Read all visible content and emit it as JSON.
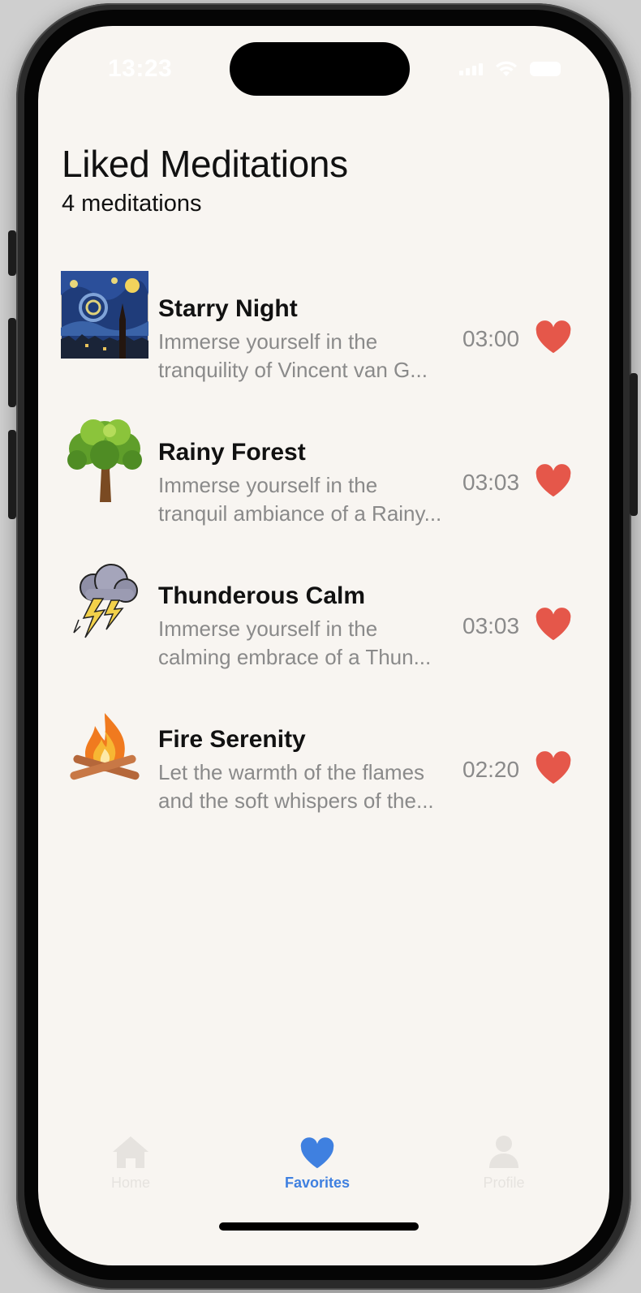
{
  "status_bar": {
    "time": "13:23"
  },
  "header": {
    "title": "Liked Meditations",
    "count_label": "4 meditations"
  },
  "meditations": [
    {
      "title": "Starry Night",
      "description_line1": "Immerse yourself in the",
      "description_line2": "tranquility of Vincent van G...",
      "duration": "03:00",
      "liked": true,
      "thumbnail": "starry-night-painting"
    },
    {
      "title": "Rainy Forest",
      "description_line1": "Immerse yourself in the",
      "description_line2": "tranquil ambiance of a Rainy...",
      "duration": "03:03",
      "liked": true,
      "thumbnail": "tree-icon"
    },
    {
      "title": "Thunderous Calm",
      "description_line1": "Immerse yourself in the",
      "description_line2": "calming embrace of a Thun...",
      "duration": "03:03",
      "liked": true,
      "thumbnail": "storm-cloud-icon"
    },
    {
      "title": "Fire Serenity",
      "description_line1": "Let the warmth of the flames",
      "description_line2": "and the soft whispers of the...",
      "duration": "02:20",
      "liked": true,
      "thumbnail": "campfire-icon"
    }
  ],
  "tab_bar": {
    "tabs": [
      {
        "label": "Home",
        "icon": "house-icon",
        "active": false
      },
      {
        "label": "Favorites",
        "icon": "heart-icon",
        "active": true
      },
      {
        "label": "Profile",
        "icon": "person-icon",
        "active": false
      }
    ]
  },
  "colors": {
    "background": "#f8f5f1",
    "heart": "#e5574a",
    "accent": "#3f80e0",
    "secondary_text": "#8a8a8a"
  }
}
